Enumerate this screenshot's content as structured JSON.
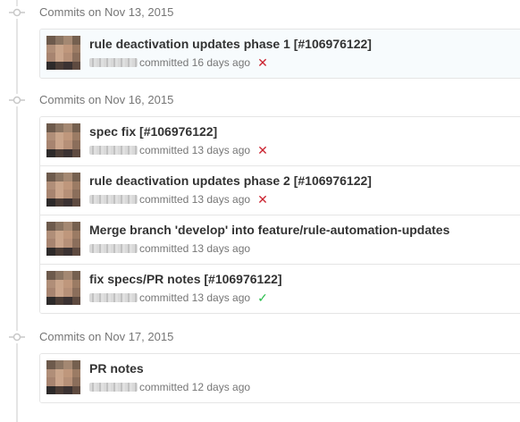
{
  "timeline": {
    "groups": [
      {
        "title": "Commits on Nov 13, 2015",
        "commits": [
          {
            "title": "rule deactivation updates phase 1 [#106976122]",
            "meta": "committed 16 days ago",
            "status": "failure",
            "status_icon": "✕"
          }
        ]
      },
      {
        "title": "Commits on Nov 16, 2015",
        "commits": [
          {
            "title": "spec fix [#106976122]",
            "meta": "committed 13 days ago",
            "status": "failure",
            "status_icon": "✕"
          },
          {
            "title": "rule deactivation updates phase 2 [#106976122]",
            "meta": "committed 13 days ago",
            "status": "failure",
            "status_icon": "✕"
          },
          {
            "title": "Merge branch 'develop' into feature/rule-automation-updates",
            "meta": "committed 13 days ago",
            "status": "none",
            "status_icon": ""
          },
          {
            "title": "fix specs/PR notes [#106976122]",
            "meta": "committed 13 days ago",
            "status": "success",
            "status_icon": "✓"
          }
        ]
      },
      {
        "title": "Commits on Nov 17, 2015",
        "commits": [
          {
            "title": "PR notes",
            "meta": "committed 12 days ago",
            "status": "none",
            "status_icon": ""
          }
        ]
      }
    ]
  },
  "colors": {
    "failure": "#cb2431",
    "success": "#2cbe4e",
    "timeline": "#e5e5e5",
    "text_muted": "#767676"
  }
}
